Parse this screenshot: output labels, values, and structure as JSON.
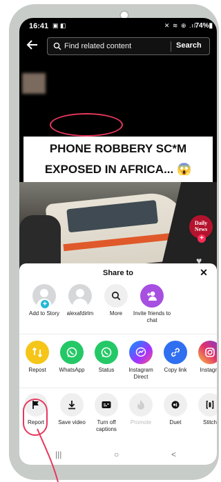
{
  "status_bar": {
    "time": "16:41",
    "notifications": "▣ ◧",
    "icons": "✕ ≋ ⊕ .ıl",
    "battery": "74%▮"
  },
  "search": {
    "placeholder": "Find related content",
    "button_label": "Search"
  },
  "video": {
    "title_lines": [
      "PHONE ROBBERY SC*M",
      "EXPOSED IN AFRICA... 😱"
    ],
    "logo_text_1": "Daily",
    "logo_text_2": "News",
    "follow_glyph": "+"
  },
  "share_sheet": {
    "title": "Share to",
    "close_glyph": "✕",
    "row1": [
      {
        "label": "Add to Story",
        "icon": "avatar-add-icon"
      },
      {
        "label": "alexafdirlm",
        "icon": "avatar-icon"
      },
      {
        "label": "More",
        "icon": "search-icon"
      },
      {
        "label": "Invite friends to chat",
        "icon": "add-friend-icon"
      }
    ],
    "row2": [
      {
        "label": "Repost",
        "icon": "repost-icon",
        "glyph": "⇅"
      },
      {
        "label": "WhatsApp",
        "icon": "whatsapp-icon",
        "glyph": "✆"
      },
      {
        "label": "Status",
        "icon": "whatsapp-status-icon",
        "glyph": "✆"
      },
      {
        "label": "Instagram Direct",
        "icon": "messenger-icon",
        "glyph": "ϟ"
      },
      {
        "label": "Copy link",
        "icon": "link-icon",
        "glyph": "🔗"
      },
      {
        "label": "Instagra",
        "icon": "instagram-icon",
        "glyph": "◎"
      }
    ],
    "row3": [
      {
        "label": "Report",
        "icon": "flag-icon",
        "glyph": "⚑"
      },
      {
        "label": "Save video",
        "icon": "download-icon",
        "glyph": "⤓"
      },
      {
        "label": "Turn off captions",
        "icon": "captions-icon",
        "glyph": "▤"
      },
      {
        "label": "Promote",
        "icon": "flame-icon",
        "glyph": "🔥"
      },
      {
        "label": "Duet",
        "icon": "duet-icon",
        "glyph": "◉"
      },
      {
        "label": "Stitch",
        "icon": "stitch-icon",
        "glyph": "⌷"
      }
    ]
  },
  "nav": {
    "recents": "|||",
    "home": "○",
    "back": "<"
  },
  "colors": {
    "annotation": "#e8375e",
    "tiktok_red": "#fe2c55"
  }
}
